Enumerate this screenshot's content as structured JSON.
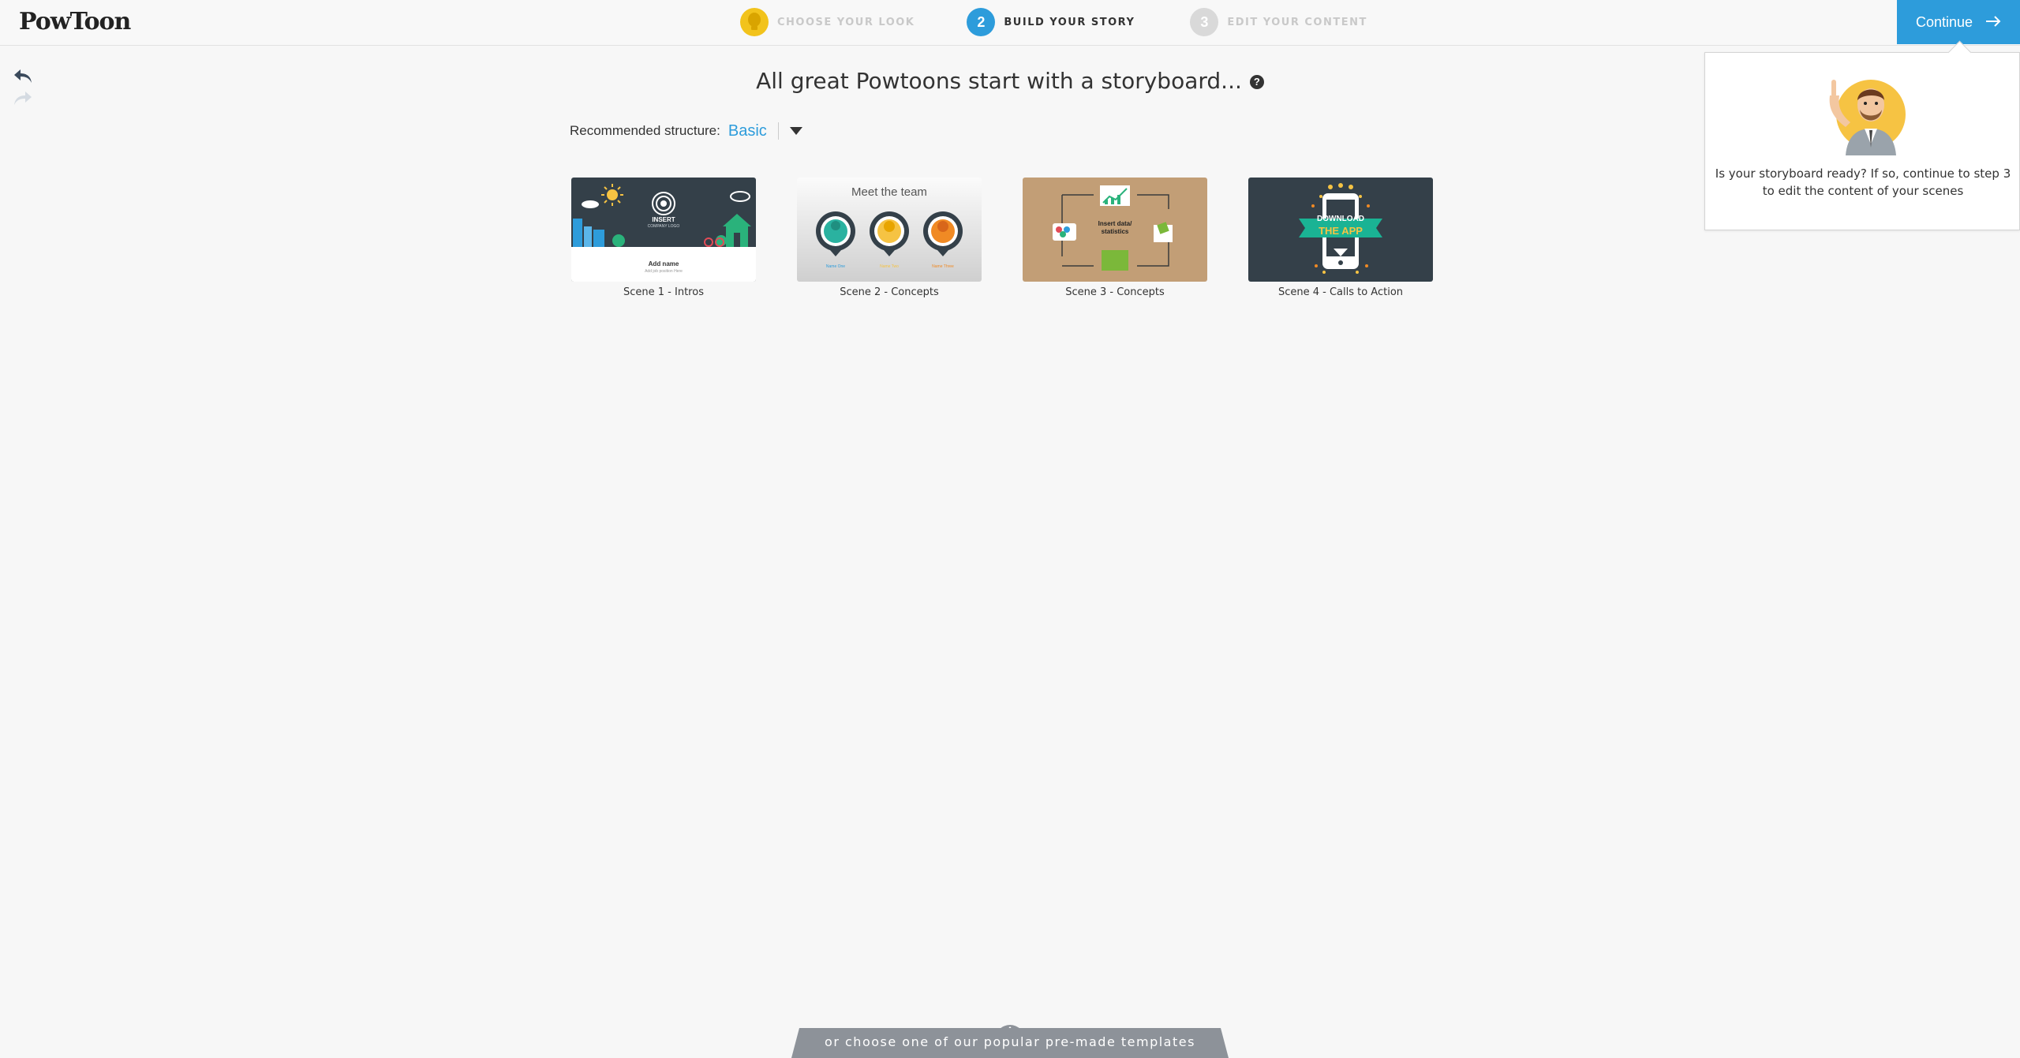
{
  "header": {
    "logo_text": "PowToon",
    "steps": [
      {
        "number": "",
        "label": "CHOOSE YOUR LOOK"
      },
      {
        "number": "2",
        "label": "BUILD YOUR STORY"
      },
      {
        "number": "3",
        "label": "EDIT YOUR CONTENT"
      }
    ],
    "continue_label": "Continue"
  },
  "main": {
    "title": "All great Powtoons start with a storyboard...",
    "structure_label": "Recommended structure:",
    "structure_value": "Basic",
    "scenes": [
      {
        "label": "Scene 1 - Intros",
        "thumb_text": {
          "line1": "INSERT",
          "line2": "COMPANY LOGO",
          "name": "Add name",
          "sub": "Add job position Here"
        }
      },
      {
        "label": "Scene 2 - Concepts",
        "thumb_text": {
          "title": "Meet the team",
          "names": [
            "Name One",
            "Name Two",
            "Name Three"
          ]
        }
      },
      {
        "label": "Scene 3 - Concepts",
        "thumb_text": {
          "center": "Insert data/ statistics"
        }
      },
      {
        "label": "Scene 4 - Calls to Action",
        "thumb_text": {
          "line1": "DOWNLOAD",
          "line2": "THE APP"
        }
      }
    ]
  },
  "tooltip": {
    "message": "Is your storyboard ready? If so, continue to step 3 to edit the content of your scenes"
  },
  "footer": {
    "templates_label": "or choose one of our popular pre-made templates"
  },
  "colors": {
    "accent": "#2d9cdb",
    "step1": "#f2c31c",
    "inactive": "#d9d9d9",
    "footer_tab": "#8d9299"
  },
  "icons": [
    "undo-icon",
    "redo-icon",
    "help-icon",
    "dropdown-caret-icon",
    "arrow-right-icon",
    "chevron-up-icon"
  ]
}
